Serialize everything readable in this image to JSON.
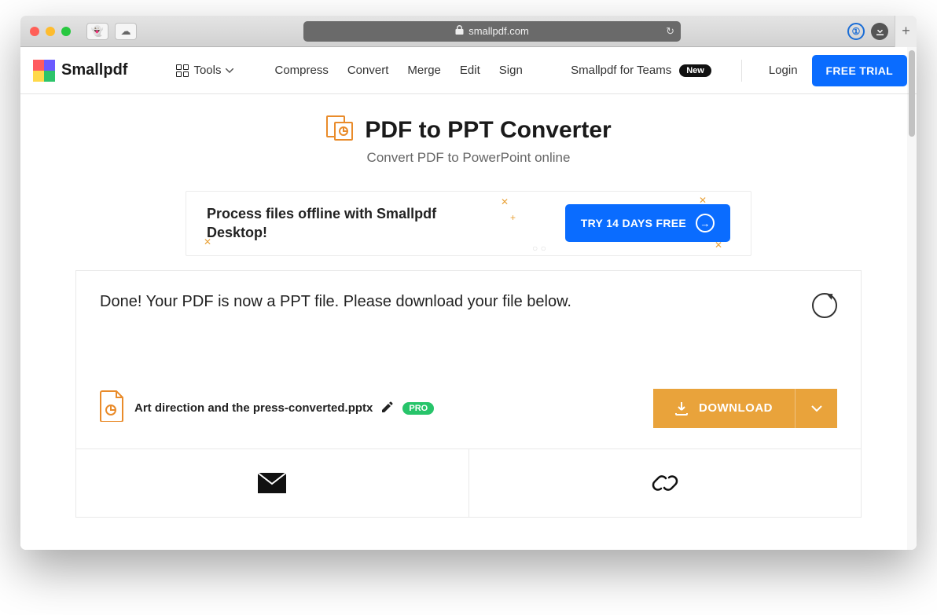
{
  "browser": {
    "url_host": "smallpdf.com"
  },
  "nav": {
    "brand": "Smallpdf",
    "tools": "Tools",
    "items": [
      "Compress",
      "Convert",
      "Merge",
      "Edit",
      "Sign"
    ],
    "teams": "Smallpdf for Teams",
    "new_badge": "New",
    "login": "Login",
    "cta": "FREE TRIAL"
  },
  "page": {
    "title": "PDF to PPT Converter",
    "subtitle": "Convert PDF to PowerPoint online"
  },
  "promo": {
    "text": "Process files offline with Smallpdf Desktop!",
    "button": "TRY 14 DAYS FREE"
  },
  "result": {
    "message": "Done! Your PDF is now a PPT file. Please download your file below.",
    "filename": "Art direction and the press-converted.pptx",
    "pro_badge": "PRO",
    "download": "DOWNLOAD"
  }
}
